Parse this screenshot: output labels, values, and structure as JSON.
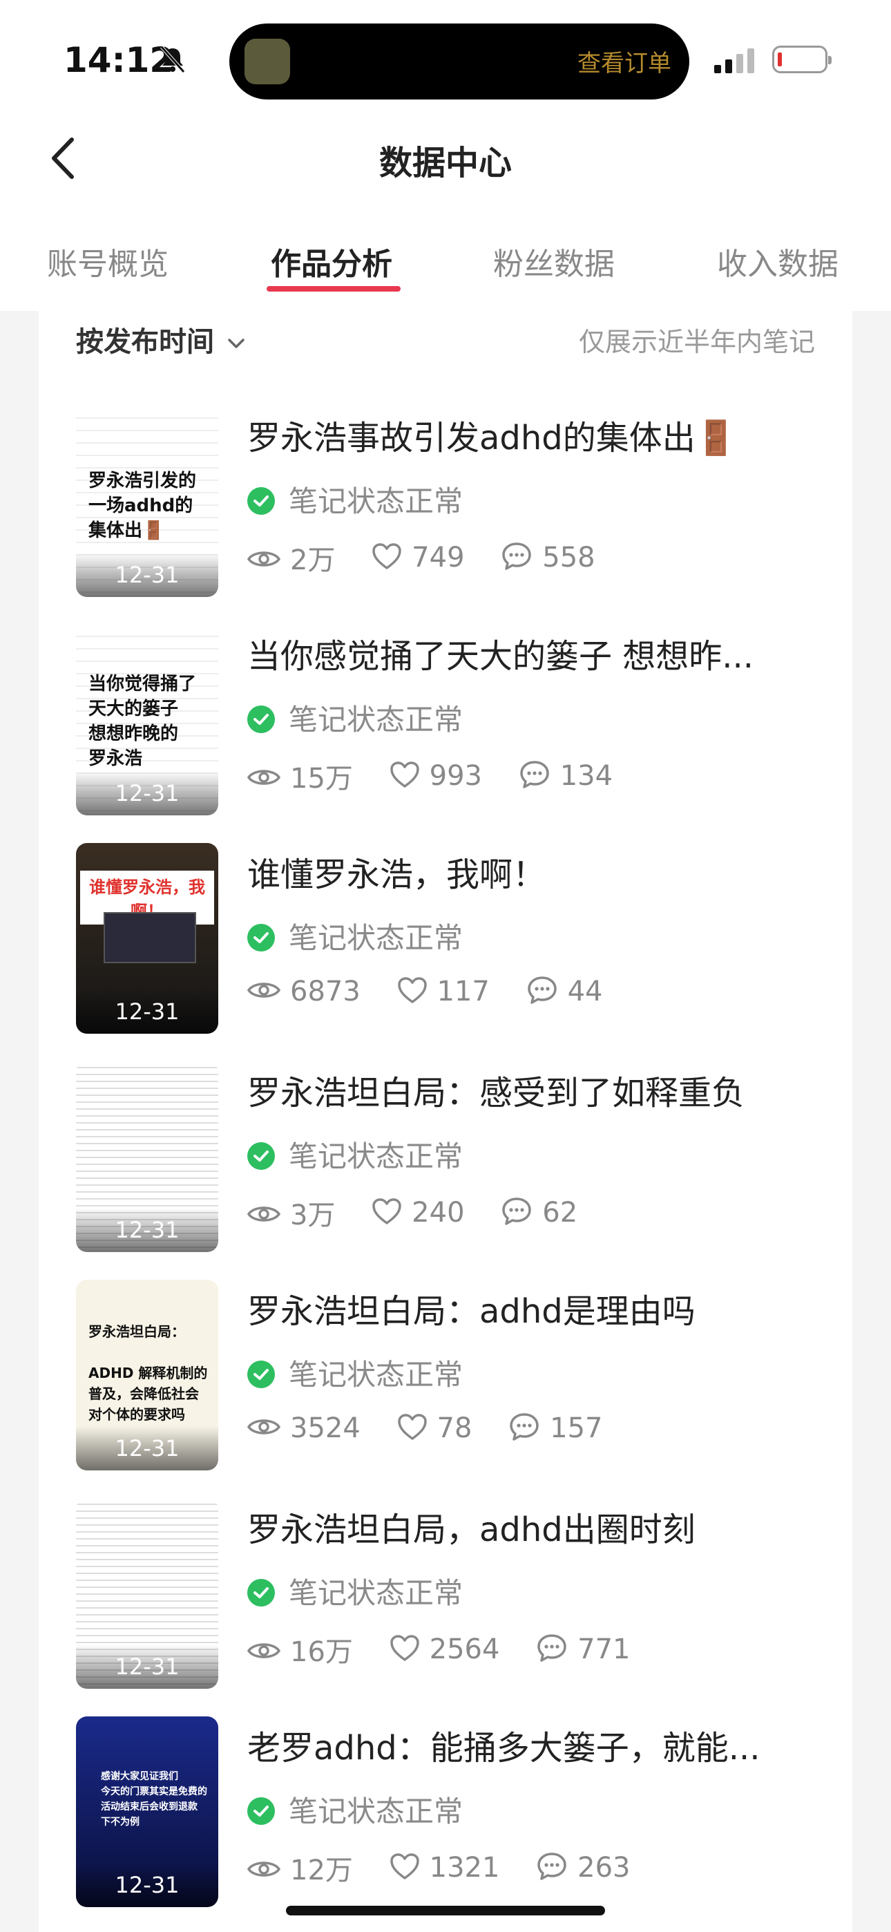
{
  "status_bar": {
    "time": "14:12",
    "island_text": "查看订单"
  },
  "header": {
    "title": "数据中心"
  },
  "tabs": [
    {
      "label": "账号概览"
    },
    {
      "label": "作品分析"
    },
    {
      "label": "粉丝数据"
    },
    {
      "label": "收入数据"
    }
  ],
  "filter": {
    "sort_label": "按发布时间",
    "hint": "仅展示近半年内笔记"
  },
  "notes": [
    {
      "title": "罗永浩事故引发adhd的集体出🚪",
      "status": "笔记状态正常",
      "views": "2万",
      "likes": "749",
      "comments": "558",
      "date": "12-31",
      "thumb_text": "罗永浩引发的\n一场adhd的\n集体出🚪"
    },
    {
      "title": "当你感觉捅了天大的篓子 想想昨...",
      "status": "笔记状态正常",
      "views": "15万",
      "likes": "993",
      "comments": "134",
      "date": "12-31",
      "thumb_text": "当你觉得捅了\n天大的篓子\n想想昨晚的\n罗永浩"
    },
    {
      "title": "谁懂罗永浩，我啊！",
      "status": "笔记状态正常",
      "views": "6873",
      "likes": "117",
      "comments": "44",
      "date": "12-31",
      "thumb_text": "谁懂罗永浩，我啊！"
    },
    {
      "title": "罗永浩坦白局：感受到了如释重负",
      "status": "笔记状态正常",
      "views": "3万",
      "likes": "240",
      "comments": "62",
      "date": "12-31",
      "thumb_text": ""
    },
    {
      "title": "罗永浩坦白局：adhd是理由吗",
      "status": "笔记状态正常",
      "views": "3524",
      "likes": "78",
      "comments": "157",
      "date": "12-31",
      "thumb_text": "罗永浩坦白局：\n\nADHD 解释机制的\n普及，会降低社会\n对个体的要求吗"
    },
    {
      "title": "罗永浩坦白局，adhd出圈时刻",
      "status": "笔记状态正常",
      "views": "16万",
      "likes": "2564",
      "comments": "771",
      "date": "12-31",
      "thumb_text": ""
    },
    {
      "title": "老罗adhd：能捅多大篓子，就能...",
      "status": "笔记状态正常",
      "views": "12万",
      "likes": "1321",
      "comments": "263",
      "date": "12-31",
      "thumb_text": "感谢大家见证我们\n今天的门票其实是免费的\n活动结束后会收到退款\n下不为例"
    }
  ]
}
